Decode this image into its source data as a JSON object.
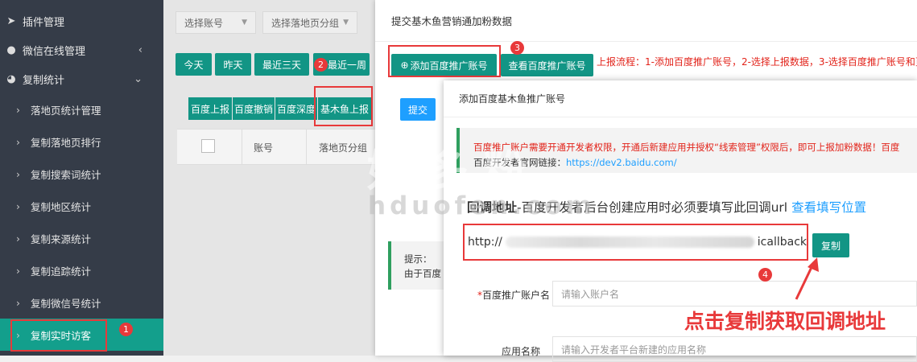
{
  "sidebar": {
    "top_items": [
      {
        "label": "插件管理",
        "icon": "send-icon"
      },
      {
        "label": "微信在线管理",
        "icon": "wechat-icon",
        "arrow": "‹"
      },
      {
        "label": "复制统计",
        "icon": "pie-chart-icon",
        "arrow": "⌄"
      }
    ],
    "sub_items": [
      {
        "label": "落地页统计管理"
      },
      {
        "label": "复制落地页排行"
      },
      {
        "label": "复制搜索词统计"
      },
      {
        "label": "复制地区统计"
      },
      {
        "label": "复制来源统计"
      },
      {
        "label": "复制追踪统计"
      },
      {
        "label": "复制微信号统计"
      },
      {
        "label": "复制实时访客"
      }
    ]
  },
  "filters": {
    "account_select": "选择账号",
    "group_select": "选择落地页分组"
  },
  "date_buttons": [
    "今天",
    "昨天",
    "最近三天",
    "最近一周"
  ],
  "report_buttons": [
    "百度上报",
    "百度撤销",
    "百度深度",
    "基木鱼上报"
  ],
  "table": {
    "col_account": "账号",
    "col_group": "落地页分组"
  },
  "dialog1": {
    "title": "提交基木鱼营销通加粉数据",
    "add_account_btn": "添加百度推广账号",
    "view_account_btn": "查看百度推广账号",
    "flow_text": "上报流程：1-添加百度推广账号，2-选择上报数据，3-选择百度推广账号和页",
    "submit_btn": "提交",
    "tip_title": "提示：",
    "tip_text": "由于百度"
  },
  "dialog2": {
    "title": "添加百度基木鱼推广账号",
    "notice_warn": "百度推广账户需要开通开发者权限，开通后新建应用并授权“线索管理”权限后，即可上报加粉数据！百度",
    "notice_link_label": "百度开发者官网链接：",
    "notice_link": "https://dev2.baidu.com/",
    "callback_title_bold": "回调地址",
    "callback_title_rest": "-百度开发者后台创建应用时必须要填写此回调url",
    "callback_link": "查看填写位置",
    "url_prefix": "http://",
    "url_suffix": "icallback",
    "copy_btn": "复制",
    "field1_label": "百度推广账户名",
    "field1_placeholder": "请输入账户名",
    "field2_label": "应用名称",
    "field2_placeholder": "请输入开发者平台新建的应用名称"
  },
  "annotations": {
    "badges": [
      "1",
      "2",
      "3",
      "4"
    ],
    "callout": "点击复制获取回调地址"
  },
  "watermark": {
    "cn": "好多粉",
    "en": "hduofen.com"
  },
  "colors": {
    "sidebar_bg": "#353c48",
    "accent_teal": "#129585",
    "annotation_red": "#e8393a",
    "link_blue": "#1e9fff"
  }
}
